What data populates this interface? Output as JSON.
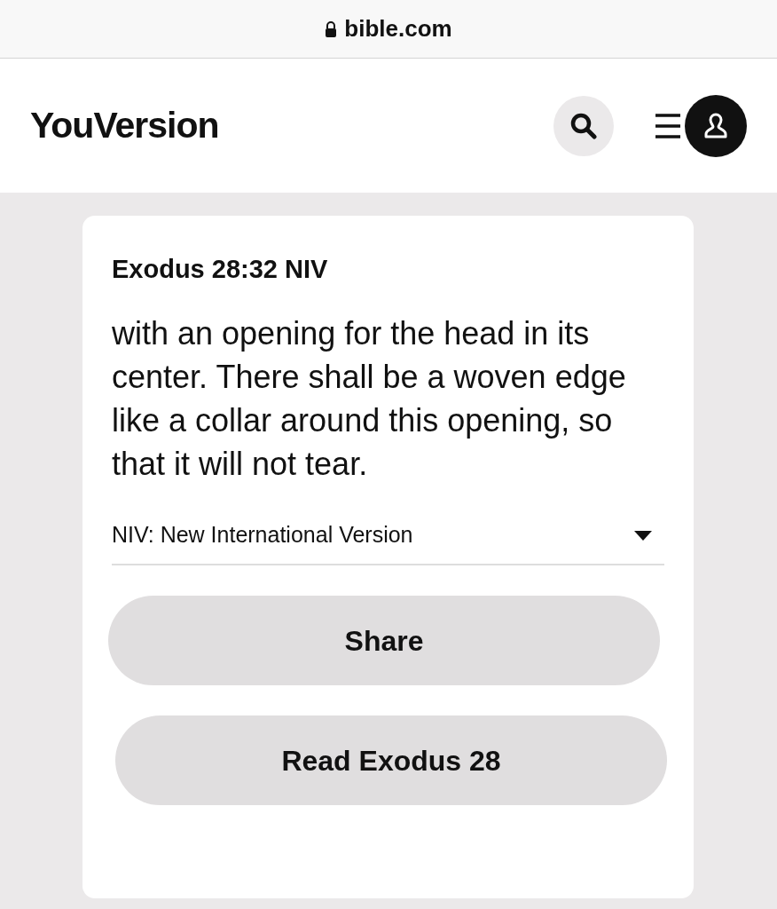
{
  "address_bar": {
    "url": "bible.com"
  },
  "header": {
    "logo": "YouVersion"
  },
  "card": {
    "reference": "Exodus 28:32 NIV",
    "verse": "with an opening for the head in its center. There shall be a woven edge like a collar around this opening, so that it will not tear.",
    "version_selector": {
      "label": "NIV: New International Version"
    },
    "buttons": [
      {
        "label": "Share"
      },
      {
        "label": "Read Exodus 28"
      }
    ]
  }
}
